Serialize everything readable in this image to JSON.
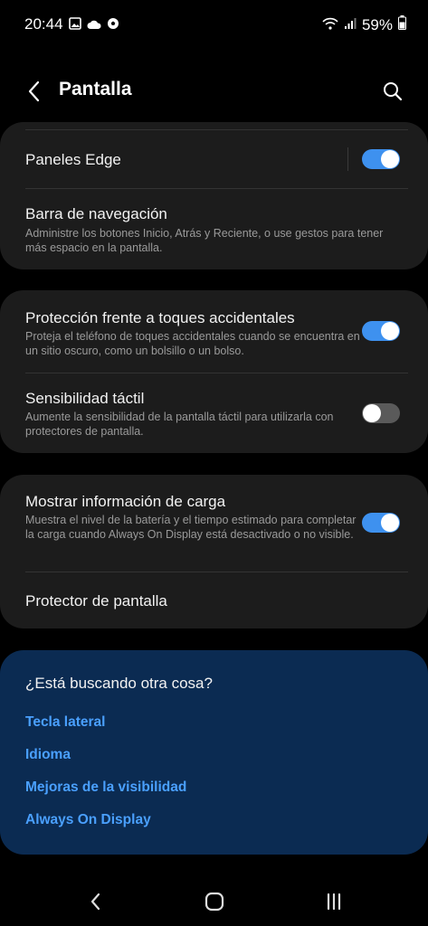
{
  "status": {
    "time": "20:44",
    "battery": "59%",
    "left_icons": [
      "image-icon",
      "cloud-icon",
      "soccer-ball-icon"
    ],
    "right_icons": [
      "wifi-icon",
      "signal-icon",
      "battery-icon"
    ]
  },
  "header": {
    "title": "Pantalla"
  },
  "cards": [
    {
      "rows": [
        {
          "title": "Paneles Edge",
          "toggle": true
        },
        {
          "title": "Barra de navegación",
          "subtitle": "Administre los botones Inicio, Atrás y Reciente, o use gestos para tener más espacio en la pantalla."
        }
      ]
    },
    {
      "rows": [
        {
          "title": "Protección frente a toques accidentales",
          "subtitle": "Proteja el teléfono de toques accidentales cuando se encuentra en un sitio oscuro, como un bolsillo o un bolso.",
          "toggle": true
        },
        {
          "title": "Sensibilidad táctil",
          "subtitle": "Aumente la sensibilidad de la pantalla táctil para utilizarla con protectores de pantalla.",
          "toggle": false
        }
      ]
    },
    {
      "rows": [
        {
          "title": "Mostrar información de carga",
          "subtitle": "Muestra el nivel de la batería y el tiempo estimado para completar la carga cuando Always On Display está desactivado o no visible.",
          "toggle": true
        },
        {
          "title": "Protector de pantalla"
        }
      ]
    }
  ],
  "suggestions": {
    "title": "¿Está buscando otra cosa?",
    "links": [
      "Tecla lateral",
      "Idioma",
      "Mejoras de la visibilidad",
      "Always On Display"
    ]
  },
  "colors": {
    "background": "#000000",
    "card": "#1c1c1c",
    "accent": "#3e91ef",
    "suggest_bg": "#0b2b52",
    "link": "#4aa0ff"
  }
}
